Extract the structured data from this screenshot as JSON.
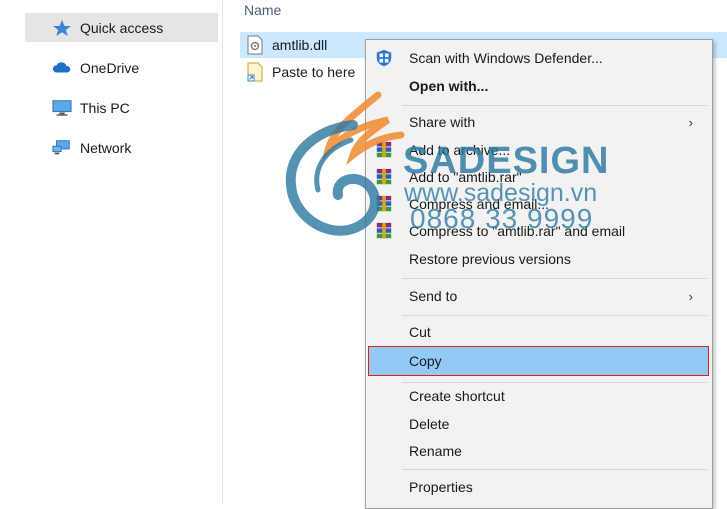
{
  "nav": {
    "items": [
      {
        "label": "Quick access",
        "icon": "star-icon"
      },
      {
        "label": "OneDrive",
        "icon": "cloud-icon"
      },
      {
        "label": "This PC",
        "icon": "computer-icon"
      },
      {
        "label": "Network",
        "icon": "network-icon"
      }
    ]
  },
  "file_list": {
    "column_name": "Name",
    "files": [
      {
        "name": "amtlib.dll",
        "icon": "dll-file-icon"
      },
      {
        "name": "Paste to here",
        "icon": "file-shortcut-icon"
      }
    ]
  },
  "context_menu": {
    "scan": "Scan with Windows Defender...",
    "open_with": "Open with...",
    "share_with": "Share with",
    "add_archive": "Add to archive...",
    "add_rar": "Add to \"amtlib.rar\"",
    "compress_email": "Compress and email...",
    "compress_rar_email": "Compress to \"amtlib.rar\" and email",
    "restore": "Restore previous versions",
    "send_to": "Send to",
    "cut": "Cut",
    "copy": "Copy",
    "create_shortcut": "Create shortcut",
    "delete": "Delete",
    "rename": "Rename",
    "properties": "Properties",
    "submenu_arrow": "›"
  },
  "watermark": {
    "brand": "SADESIGN",
    "url": "www.sadesign.vn",
    "phone": "0868 33 9999"
  },
  "colors": {
    "selection": "#cce8ff",
    "menu_highlight": "#91c9f7",
    "highlight_border": "#e02020",
    "watermark": "#2c78a0",
    "watermark_flame": "#f08a30"
  }
}
